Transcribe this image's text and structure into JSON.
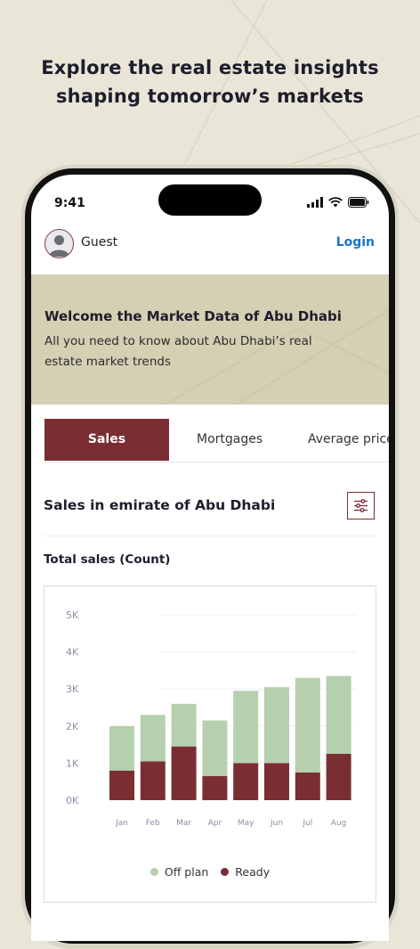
{
  "headline": {
    "line1": "Explore the real estate insights",
    "line2": "shaping tomorrow’s markets"
  },
  "status_bar": {
    "time": "9:41",
    "icons": [
      "cellular-signal-icon",
      "wifi-icon",
      "battery-icon"
    ]
  },
  "app_bar": {
    "user_name": "Guest",
    "login_label": "Login",
    "avatar_icon": "user-avatar-icon"
  },
  "banner": {
    "title": "Welcome the Market Data of Abu Dhabi",
    "subtitle": "All you need to know about Abu Dhabi’s real estate market trends"
  },
  "tabs": [
    {
      "label": "Sales",
      "active": true
    },
    {
      "label": "Mortgages",
      "active": false
    },
    {
      "label": "Average prices",
      "active": false
    }
  ],
  "section": {
    "title": "Sales in emirate of Abu Dhabi",
    "filter_icon": "filter-sliders-icon"
  },
  "chart_title": "Total sales (Count)",
  "colors": {
    "accent": "#7a2e33",
    "link": "#1673c9",
    "off_plan": "#b6cfad",
    "ready": "#7a2e33",
    "banner_bg": "#d5cfb4",
    "page_bg": "#e9e6d8"
  },
  "chart_data": {
    "type": "bar",
    "stacked": true,
    "categories": [
      "Jan",
      "Feb",
      "Mar",
      "Apr",
      "May",
      "Jun",
      "Jul",
      "Aug"
    ],
    "series": [
      {
        "name": "Ready",
        "color": "#7a2e33",
        "values": [
          800,
          1050,
          1450,
          650,
          1000,
          1000,
          750,
          1250
        ]
      },
      {
        "name": "Off plan",
        "color": "#b6cfad",
        "values": [
          1200,
          1250,
          1150,
          1500,
          1950,
          2050,
          2550,
          2100
        ]
      }
    ],
    "y_ticks": [
      "0K",
      "1K",
      "2K",
      "3K",
      "4K",
      "5K"
    ],
    "ylim": [
      0,
      5000
    ],
    "grid": true,
    "legend": [
      "Off plan",
      "Ready"
    ],
    "legend_position": "bottom-center"
  }
}
